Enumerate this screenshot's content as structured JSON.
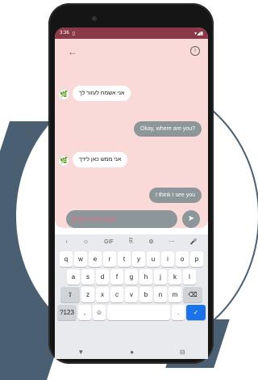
{
  "status": {
    "time": "3:36",
    "icons": [
      "sim-card-icon"
    ],
    "right": "▾◢▮"
  },
  "toolbar": {
    "back_label": "←",
    "info_label": "i"
  },
  "messages": [
    {
      "side": "in",
      "text": "אני אשמח לעזור לך"
    },
    {
      "side": "out",
      "text": "Okay, where are you?"
    },
    {
      "side": "in",
      "text": "אני ממש כאן לידך"
    },
    {
      "side": "out",
      "text": "I think I see you"
    }
  ],
  "composer": {
    "placeholder": "Type a message..",
    "send_label": "➤"
  },
  "keyboard": {
    "toolbar": [
      "‹",
      "☺",
      "GIF",
      "⎘",
      "⚙",
      "⋯",
      "🎤"
    ],
    "row1": [
      "q",
      "w",
      "e",
      "r",
      "t",
      "y",
      "u",
      "i",
      "o",
      "p"
    ],
    "row2": [
      "a",
      "s",
      "d",
      "f",
      "g",
      "h",
      "j",
      "k",
      "l"
    ],
    "row3": [
      "⇧",
      "z",
      "x",
      "c",
      "v",
      "b",
      "n",
      "m",
      "⌫"
    ],
    "row4": [
      "?123",
      ",",
      "☺",
      "",
      ".",
      "✓"
    ]
  },
  "nav": [
    "▼",
    "●",
    "⊟"
  ],
  "colors": {
    "accent": "#8a3a46",
    "chat_bg": "#fad9d9",
    "bubble_out": "#8d9799"
  }
}
